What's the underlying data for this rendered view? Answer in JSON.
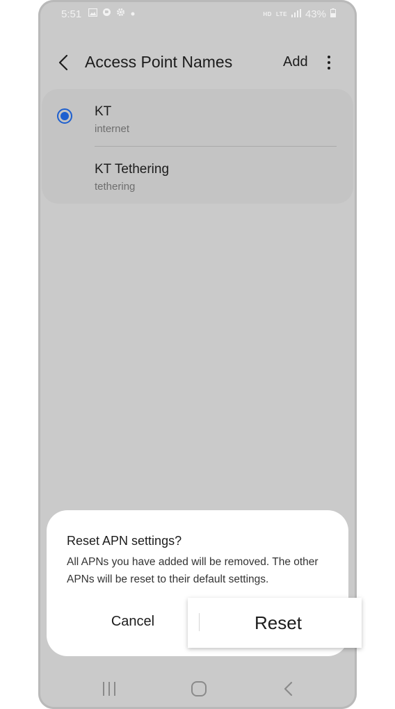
{
  "status_bar": {
    "time": "5:51",
    "left_icons": [
      "gallery-icon",
      "bixby-icon",
      "gear-icon",
      "dot-icon"
    ],
    "network_badges": [
      "HD",
      "LTE"
    ],
    "battery": "43%"
  },
  "header": {
    "title": "Access Point Names",
    "add_label": "Add"
  },
  "apn_list": [
    {
      "name": "KT",
      "type": "internet",
      "selected": true
    },
    {
      "name": "KT Tethering",
      "type": "tethering",
      "selected": false
    }
  ],
  "dialog": {
    "title": "Reset APN settings?",
    "message": "All APNs you have added will be removed. The other APNs will be reset to their default settings.",
    "cancel_label": "Cancel",
    "reset_label": "Reset"
  },
  "navbar": {
    "icons": [
      "recents-icon",
      "home-icon",
      "back-icon"
    ]
  },
  "colors": {
    "accent": "#1d5fcf",
    "background_dimmed": "#cacaca",
    "dialog_background": "#ffffff"
  }
}
